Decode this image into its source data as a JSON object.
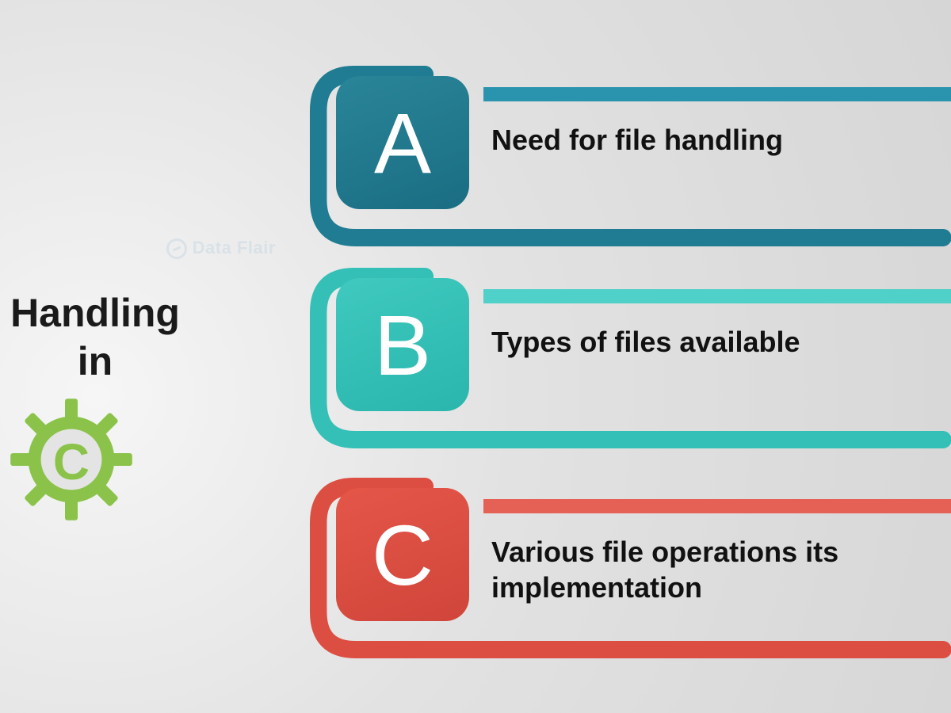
{
  "title": {
    "line1": "Handling",
    "line2": "in"
  },
  "gear": {
    "letter": "C",
    "color": "#8bc34a"
  },
  "watermark": {
    "text": "Data Flair"
  },
  "colors": {
    "a_tile": "#1f7c92",
    "a_accent": "#2a94af",
    "b_tile": "#34c0b6",
    "b_accent": "#4fd0c8",
    "c_tile": "#dd4e42",
    "c_accent": "#e56156"
  },
  "items": [
    {
      "letter": "A",
      "label": "Need for file handling"
    },
    {
      "letter": "B",
      "label": "Types of files available"
    },
    {
      "letter": "C",
      "label": "Various file operations its implementation"
    }
  ]
}
